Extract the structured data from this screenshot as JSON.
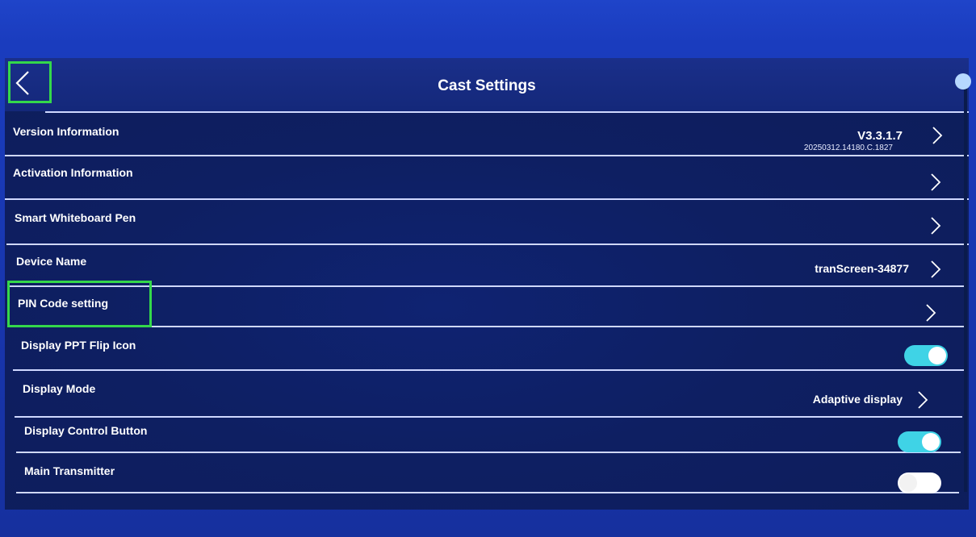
{
  "header": {
    "title": "Cast Settings"
  },
  "rows": [
    {
      "label": "Version Information",
      "value": "V3.3.1.7",
      "sub": "20250312.14180.C.1827"
    },
    {
      "label": "Activation Information"
    },
    {
      "label": "Smart Whiteboard Pen"
    },
    {
      "label": "Device Name",
      "value": "tranScreen-34877"
    },
    {
      "label": "PIN Code setting"
    },
    {
      "label": "Display PPT Flip Icon",
      "toggle": "on"
    },
    {
      "label": "Display Mode",
      "value": "Adaptive display"
    },
    {
      "label": "Display Control Button",
      "toggle": "on"
    },
    {
      "label": "Main Transmitter",
      "toggle": "off"
    }
  ],
  "colors": {
    "toggle_on": "#3fd3e6",
    "highlight": "#34d84b",
    "divider": "#cfd8ff"
  }
}
